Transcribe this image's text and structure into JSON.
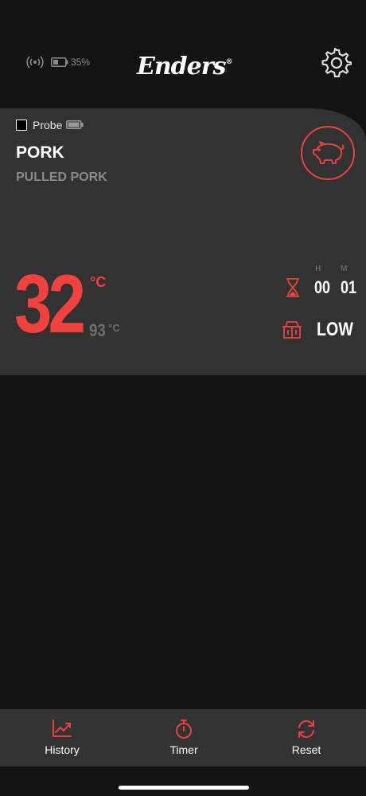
{
  "status": {
    "battery_percent": "35%"
  },
  "brand": {
    "name": "Enders",
    "mark": "®"
  },
  "probe": {
    "label": "Probe",
    "meat": "PORK",
    "cut": "PULLED PORK",
    "current_temp": "32",
    "current_unit": "°C",
    "target_temp": "93",
    "target_unit": "°C",
    "timer": {
      "hours_label": "H",
      "minutes_label": "M",
      "hours": "00",
      "minutes": "01"
    },
    "heat_level": "LOW"
  },
  "nav": {
    "history": "History",
    "timer": "Timer",
    "reset": "Reset"
  },
  "colors": {
    "accent": "#f2423f",
    "card": "#323232",
    "background": "#141214",
    "bar": "#333333"
  },
  "icons": [
    "signal-icon",
    "battery-icon",
    "gear-icon",
    "pig-icon",
    "hourglass-icon",
    "grill-icon",
    "chart-icon",
    "stopwatch-icon",
    "refresh-icon"
  ]
}
